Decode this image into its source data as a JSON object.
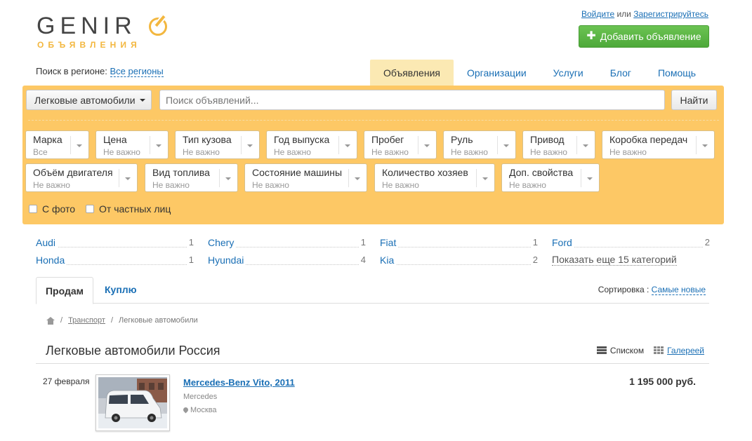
{
  "logo": {
    "word": "GENIR",
    "sub": "ОБЪЯВЛЕНИЯ"
  },
  "auth": {
    "login": "Войдите",
    "or": "или",
    "register": "Зарегистрируйтесь"
  },
  "add_button": {
    "icon": "plus-icon",
    "label": "Добавить объявление"
  },
  "region": {
    "label": "Поиск в регионе:",
    "value": "Все регионы"
  },
  "nav": [
    "Объявления",
    "Организации",
    "Услуги",
    "Блог",
    "Помощь"
  ],
  "search": {
    "category": "Легковые автомобили",
    "placeholder": "Поиск объявлений...",
    "button": "Найти"
  },
  "filters": [
    {
      "label": "Марка",
      "value": "Все"
    },
    {
      "label": "Цена",
      "value": "Не важно"
    },
    {
      "label": "Тип кузова",
      "value": "Не важно"
    },
    {
      "label": "Год выпуска",
      "value": "Не важно"
    },
    {
      "label": "Пробег",
      "value": "Не важно"
    },
    {
      "label": "Руль",
      "value": "Не важно"
    },
    {
      "label": "Привод",
      "value": "Не важно"
    },
    {
      "label": "Коробка передач",
      "value": "Не важно"
    },
    {
      "label": "Объём двигателя",
      "value": "Не важно"
    },
    {
      "label": "Вид топлива",
      "value": "Не важно"
    },
    {
      "label": "Состояние машины",
      "value": "Не важно"
    },
    {
      "label": "Количество хозяев",
      "value": "Не важно"
    },
    {
      "label": "Доп. свойства",
      "value": "Не важно"
    }
  ],
  "checkboxes": {
    "photo": "С фото",
    "private": "От частных лиц"
  },
  "brands": [
    {
      "name": "Audi",
      "count": "1"
    },
    {
      "name": "Chery",
      "count": "1"
    },
    {
      "name": "Fiat",
      "count": "1"
    },
    {
      "name": "Ford",
      "count": "2"
    },
    {
      "name": "Honda",
      "count": "1"
    },
    {
      "name": "Hyundai",
      "count": "4"
    },
    {
      "name": "Kia",
      "count": "2"
    }
  ],
  "more_categories": "Показать еще 15 категорий",
  "tabs": {
    "sell": "Продам",
    "buy": "Куплю"
  },
  "sort": {
    "label": "Сортировка :",
    "value": "Самые новые"
  },
  "breadcrumb": {
    "home_icon": "home-icon",
    "sep": "/",
    "transport": "Транспорт",
    "current": "Легковые автомобили"
  },
  "page_title": "Легковые автомобили Россия",
  "views": {
    "list": "Списком",
    "gallery": "Галереей"
  },
  "listing": {
    "date": "27 февраля",
    "title": "Mercedes-Benz Vito, 2011",
    "brand": "Mercedes",
    "city": "Москва",
    "price": "1 195 000 руб."
  }
}
